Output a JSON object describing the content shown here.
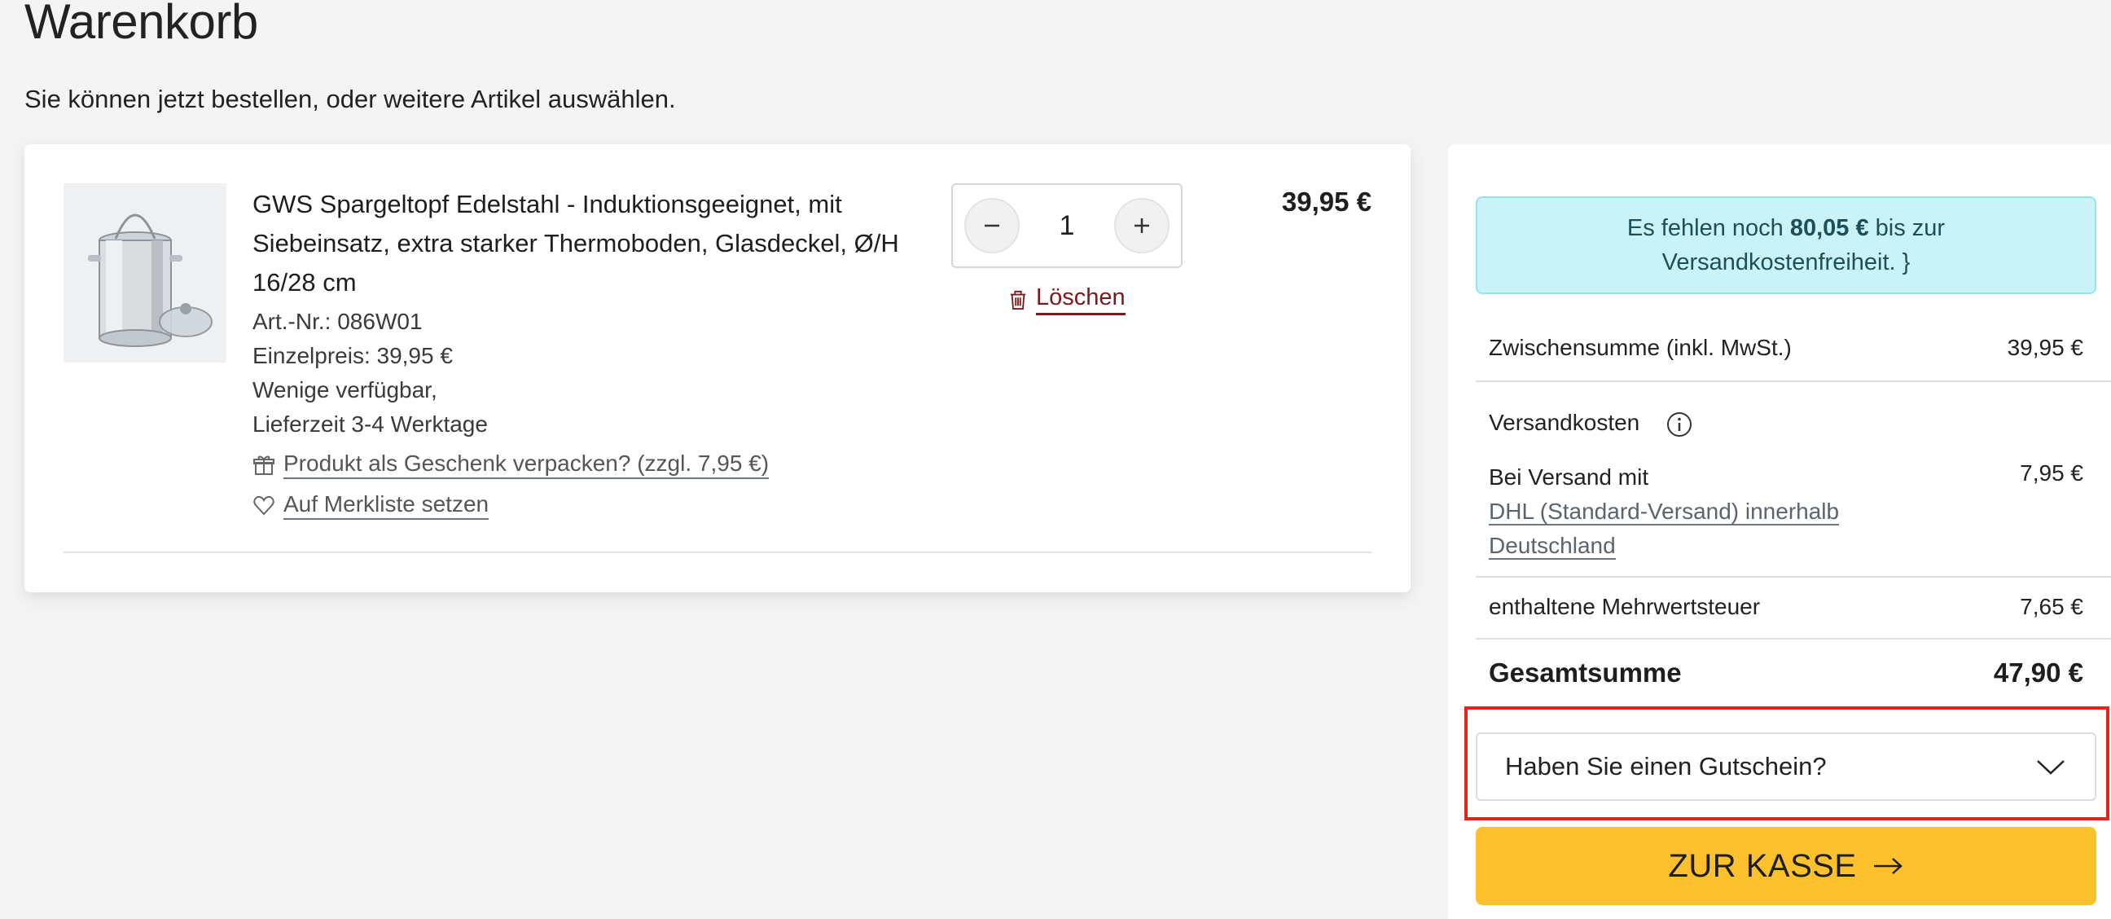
{
  "page": {
    "title": "Warenkorb",
    "subtitle": "Sie können jetzt bestellen, oder weitere Artikel auswählen."
  },
  "cart": {
    "item": {
      "name": "GWS Spargeltopf Edelstahl - Induktionsgeeignet, mit Siebeinsatz, extra starker Thermoboden, Glasdeckel, Ø/H 16/28 cm",
      "article_no": "Art.-Nr.: 086W01",
      "unit_price": "Einzelpreis: 39,95 €",
      "availability": "Wenige verfügbar,",
      "delivery": "Lieferzeit 3-4 Werktage",
      "gift_wrap_label": "Produkt als Geschenk verpacken? (zzgl. 7,95 €)",
      "wishlist_label": "Auf Merkliste setzen",
      "quantity": "1",
      "delete_label": "Löschen",
      "price": "39,95 €"
    }
  },
  "summary": {
    "notice_prefix": "Es fehlen noch ",
    "notice_amount": "80,05 €",
    "notice_suffix": " bis zur",
    "notice_line2": "Versandkostenfreiheit.",
    "subtotal_label": "Zwischensumme (inkl. MwSt.)",
    "subtotal_value": "39,95 €",
    "shipping_label": "Versandkosten",
    "shipping_method_prefix": "Bei Versand mit",
    "shipping_method_link_1": "DHL (Standard-Versand) innerhalb",
    "shipping_method_link_2": "Deutschland",
    "shipping_value": "7,95 €",
    "vat_label": "enthaltene Mehrwertsteuer",
    "vat_value": "7,65 €",
    "total_label": "Gesamtsumme",
    "total_value": "47,90 €",
    "voucher_label": "Haben Sie einen Gutschein?",
    "checkout_label": "ZUR KASSE"
  },
  "colors": {
    "page_bg": "#f4f4f4",
    "notice_bg": "#c9f3f7",
    "checkout_bg": "#fdc12e",
    "delete_color": "#7a1a1a",
    "highlight": "#e3241b"
  },
  "icons": {
    "minus": "minus-icon",
    "plus": "plus-icon",
    "trash": "trash-icon",
    "gift": "gift-icon",
    "heart": "heart-icon",
    "info": "info-icon",
    "chevron": "chevron-down-icon",
    "arrow": "arrow-right-icon"
  }
}
